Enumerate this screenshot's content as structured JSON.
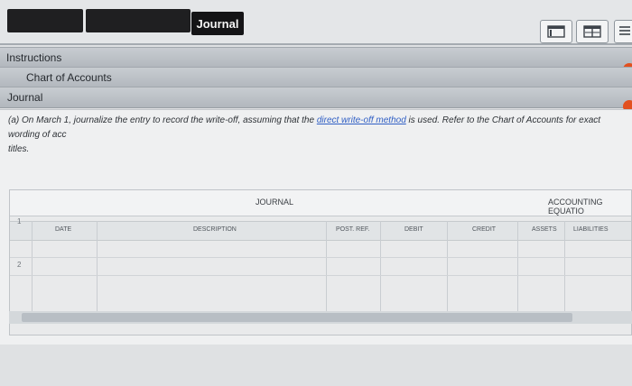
{
  "tabs": {
    "journal_label": "Journal"
  },
  "sections": {
    "instructions_label": "Instructions",
    "chart_of_accounts_label": "Chart of Accounts",
    "journal_label": "Journal"
  },
  "question": {
    "part1": "(a) On March 1, journalize the entry to record the write-off, assuming that the ",
    "link_text": "direct write-off method",
    "part2": " is used. Refer to the Chart of Accounts for exact wording of acc",
    "part3": "titles."
  },
  "journal_table": {
    "title": "JOURNAL",
    "equation_title": "ACCOUNTING EQUATIO",
    "headers": {
      "date": "DATE",
      "description": "DESCRIPTION",
      "post_ref": "POST. REF.",
      "debit": "DEBIT",
      "credit": "CREDIT",
      "assets": "ASSETS",
      "liabilities": "LIABILITIES"
    },
    "rows": [
      "1",
      "2"
    ]
  },
  "colors": {
    "accent_badge": "#e2501f",
    "link": "#2f5ec4",
    "dark_tab": "#141416"
  },
  "icons": {
    "view_single": "single-panel-icon",
    "view_split": "split-panel-icon",
    "view_list": "list-panel-icon"
  }
}
